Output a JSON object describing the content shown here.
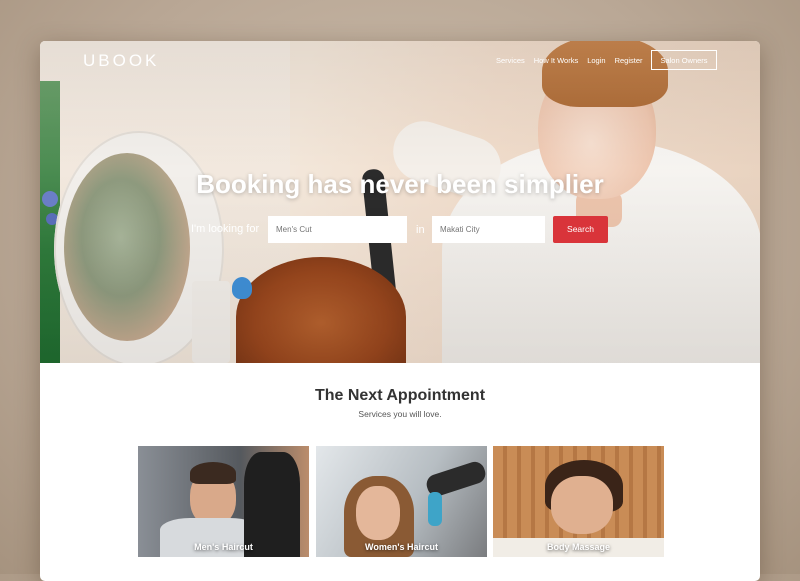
{
  "header": {
    "logo": "UBOOK",
    "nav": [
      "Services",
      "How It Works",
      "Login",
      "Register"
    ],
    "salon_owners": "Salon Owners"
  },
  "hero": {
    "headline": "Booking has never been simplier",
    "looking_label": "I'm looking for",
    "service_placeholder": "Men's Cut",
    "in_label": "in",
    "location_placeholder": "Makati City",
    "search_label": "Search"
  },
  "section": {
    "title": "The Next Appointment",
    "subtitle": "Services you will love."
  },
  "cards": [
    {
      "label": "Men's Haircut"
    },
    {
      "label": "Women's Haircut"
    },
    {
      "label": "Body Massage"
    }
  ],
  "colors": {
    "accent": "#d9343a"
  }
}
